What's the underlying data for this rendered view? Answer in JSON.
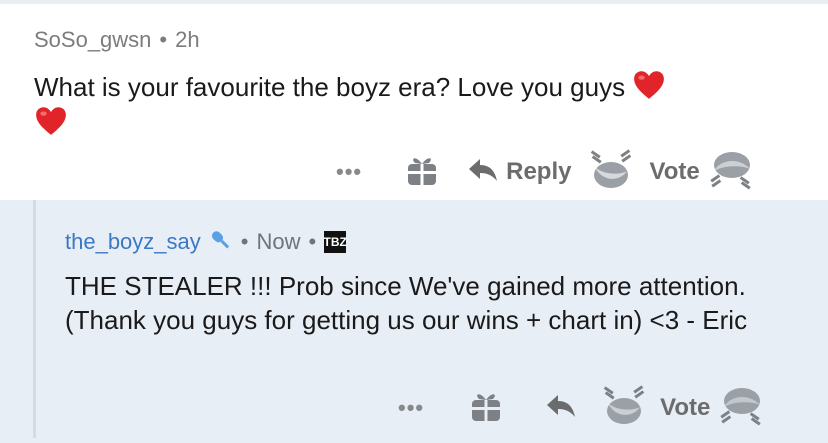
{
  "comment": {
    "username": "SoSo_gwsn",
    "separator": "•",
    "time": "2h",
    "text": "What is your favourite the boyz era? Love you guys",
    "emoji": "heart",
    "actions": {
      "more": "•••",
      "reply": "Reply",
      "vote": "Vote"
    }
  },
  "reply": {
    "username": "the_boyz_say",
    "separator": "•",
    "time": "Now",
    "flair": "TBZ",
    "text": "THE STEALER !!! Prob since We've gained more attention. (Thank you guys for getting us our wins + chart in) <3 - Eric",
    "actions": {
      "more": "•••",
      "vote": "Vote"
    }
  },
  "colors": {
    "username_link": "#3b79c4",
    "reply_background": "#e8eef6",
    "heart": "#e0242a"
  }
}
